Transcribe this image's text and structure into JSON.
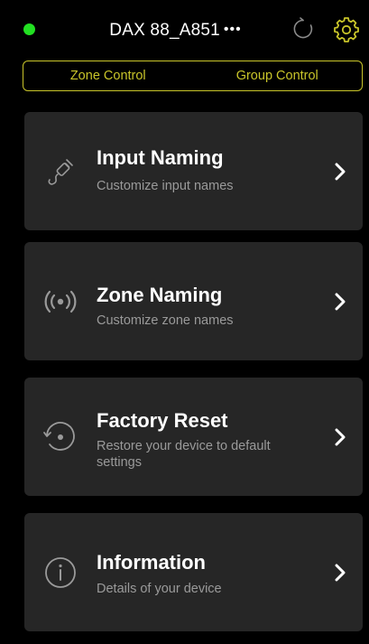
{
  "header": {
    "device_name": "DAX 88_A851",
    "more_dots": "•••",
    "status_color": "#22e022",
    "refresh_icon": "refresh-icon",
    "settings_icon": "gear-icon"
  },
  "segmented": {
    "accent": "#c9c52a",
    "tabs": [
      {
        "label": "Zone Control"
      },
      {
        "label": "Group Control"
      }
    ]
  },
  "menu": {
    "items": [
      {
        "title": "Input Naming",
        "subtitle": "Customize input names",
        "icon": "audio-cable-icon"
      },
      {
        "title": "Zone Naming",
        "subtitle": "Customize zone names",
        "icon": "broadcast-icon"
      },
      {
        "title": "Factory Reset",
        "subtitle": "Restore your device to default settings",
        "icon": "reset-icon"
      },
      {
        "title": "Information",
        "subtitle": "Details of your device",
        "icon": "info-icon"
      }
    ]
  }
}
